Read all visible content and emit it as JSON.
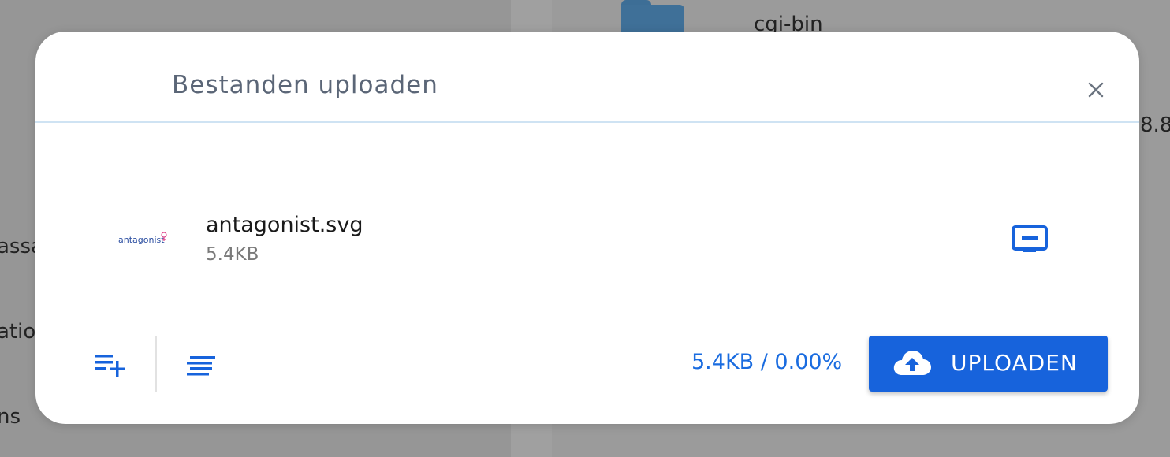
{
  "background": {
    "folder_name": "cgi-bin",
    "fragment_right": "8.8",
    "fragment_left_1": "assa",
    "fragment_left_2": "atio",
    "fragment_left_3": "ns"
  },
  "modal": {
    "title": "Bestanden uploaden",
    "close_icon": "close-icon",
    "file": {
      "name": "antagonist.svg",
      "size": "5.4KB",
      "thumbnail_text": "antagonist"
    },
    "remove_icon": "remove-file-icon",
    "footer": {
      "add_icon": "playlist-add-icon",
      "list_icon": "list-align-icon",
      "progress": "5.4KB / 0.00%",
      "upload_label": "UPLOADEN",
      "upload_icon": "cloud-upload-icon"
    }
  },
  "colors": {
    "accent": "#1763dc",
    "title": "#5b6677",
    "progress_text": "#1a6ce0"
  }
}
